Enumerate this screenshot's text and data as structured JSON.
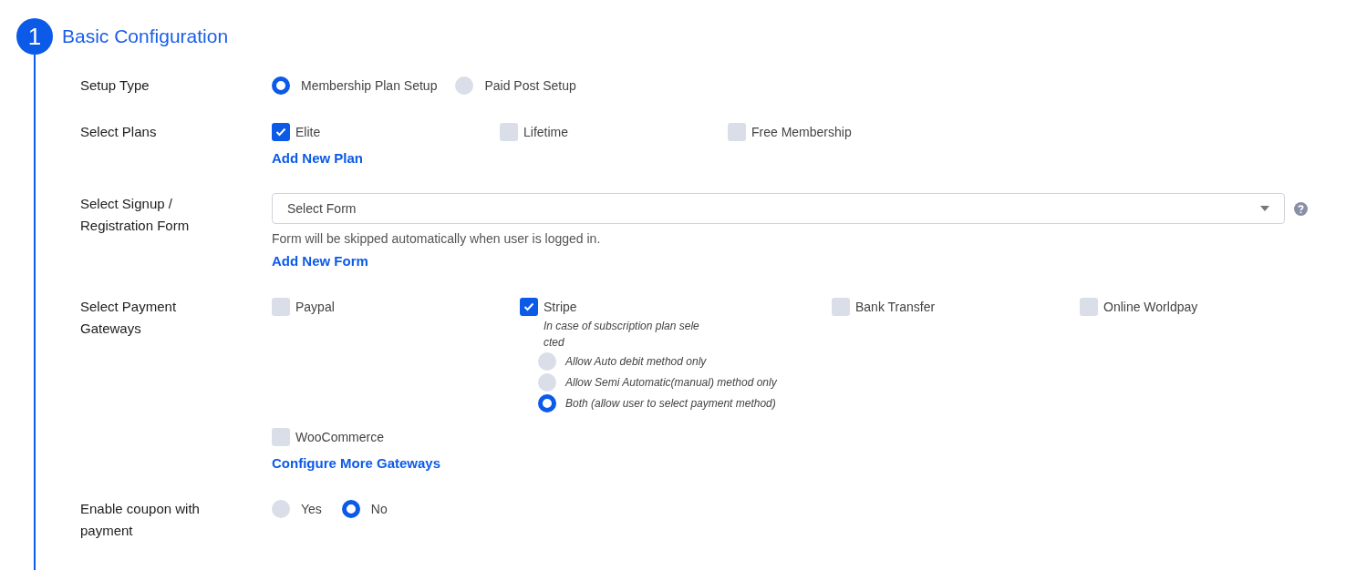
{
  "step": {
    "number": "1",
    "title": "Basic Configuration"
  },
  "setup_type": {
    "label": "Setup Type",
    "options": [
      {
        "label": "Membership Plan Setup",
        "selected": true
      },
      {
        "label": "Paid Post Setup",
        "selected": false
      }
    ]
  },
  "plans": {
    "label": "Select Plans",
    "items": [
      {
        "label": "Elite",
        "checked": true
      },
      {
        "label": "Lifetime",
        "checked": false
      },
      {
        "label": "Free Membership",
        "checked": false
      }
    ],
    "link": "Add New Plan"
  },
  "signup_form": {
    "label": "Select Signup / Registration Form",
    "placeholder": "Select Form",
    "hint": "Form will be skipped automatically when user is logged in.",
    "link": "Add New Form"
  },
  "gateways": {
    "label": "Select Payment Gateways",
    "items": [
      {
        "label": "Paypal",
        "checked": false
      },
      {
        "label": "Stripe",
        "checked": true,
        "note": "In case of subscription plan selected",
        "methods": [
          {
            "label": "Allow Auto debit method only",
            "selected": false
          },
          {
            "label": "Allow Semi Automatic(manual) method only",
            "selected": false
          },
          {
            "label": "Both (allow user to select payment method)",
            "selected": true
          }
        ]
      },
      {
        "label": "Bank Transfer",
        "checked": false
      },
      {
        "label": "Online Worldpay",
        "checked": false
      },
      {
        "label": "WooCommerce",
        "checked": false
      }
    ],
    "link": "Configure More Gateways"
  },
  "coupon": {
    "label": "Enable coupon with payment",
    "options": [
      {
        "label": "Yes",
        "selected": false
      },
      {
        "label": "No",
        "selected": true
      }
    ]
  }
}
